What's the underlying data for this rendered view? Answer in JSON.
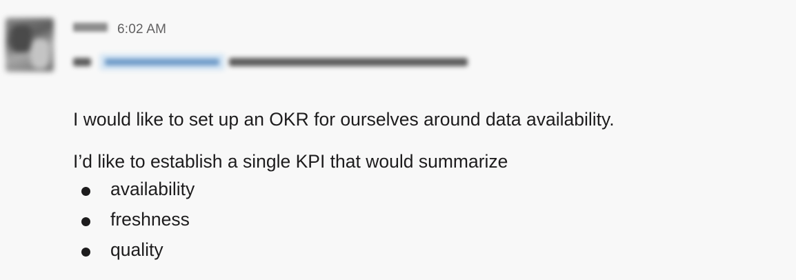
{
  "message": {
    "timestamp": "6:02 AM",
    "paragraphs": [
      "I would like to set up an OKR for ourselves around data availability.",
      "I’d like to establish a single KPI that would summarize"
    ],
    "bullets": [
      "availability",
      "freshness",
      "quality"
    ]
  },
  "icons": {
    "avatar": "user-avatar-blurred"
  },
  "colors": {
    "background": "#f8f8f8",
    "text": "#1d1c1d",
    "timestamp": "#616061",
    "mention_background": "#d6e6f4",
    "mention_text": "#6f9bc8"
  }
}
